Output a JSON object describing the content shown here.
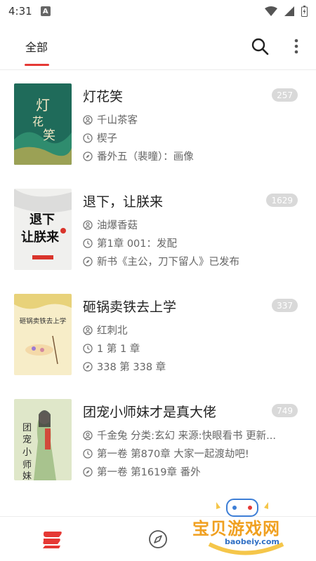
{
  "status_bar": {
    "time": "4:31",
    "notif_glyph": "A"
  },
  "header": {
    "tab_label": "全部",
    "accent_color": "#e53935"
  },
  "books": [
    {
      "title": "灯花笑",
      "count": "257",
      "author": "千山茶客",
      "last_read": "楔子",
      "latest": "番外五（裴曈）：画像",
      "cover_color": "#1f6b5a",
      "cover_text": "灯花笑"
    },
    {
      "title": "退下，让朕来",
      "count": "1629",
      "author": "油爆香菇",
      "last_read": "第1章 001：发配",
      "latest": "新书《主公，刀下留人》已发布",
      "cover_color": "#f0f0ee",
      "cover_text": "退下让朕来"
    },
    {
      "title": "砸锅卖铁去上学",
      "count": "337",
      "author": "红刺北",
      "last_read": "1 第 1 章",
      "latest": "338 第 338 章",
      "cover_color": "#f7edc8",
      "cover_text": "砸锅卖铁去上学"
    },
    {
      "title": "团宠小师妹才是真大佬",
      "count": "749",
      "author": "千金兔 分类:玄幻 来源:快眼看书 更新...",
      "last_read": "第一卷 第870章 大家一起渡劫吧!",
      "latest": "第一卷 第1619章 番外",
      "cover_color": "#dfe7c9",
      "cover_text": "团宠小师妹"
    }
  ],
  "watermark": {
    "text": "宝贝游戏网",
    "url": "baobeiy.com"
  }
}
